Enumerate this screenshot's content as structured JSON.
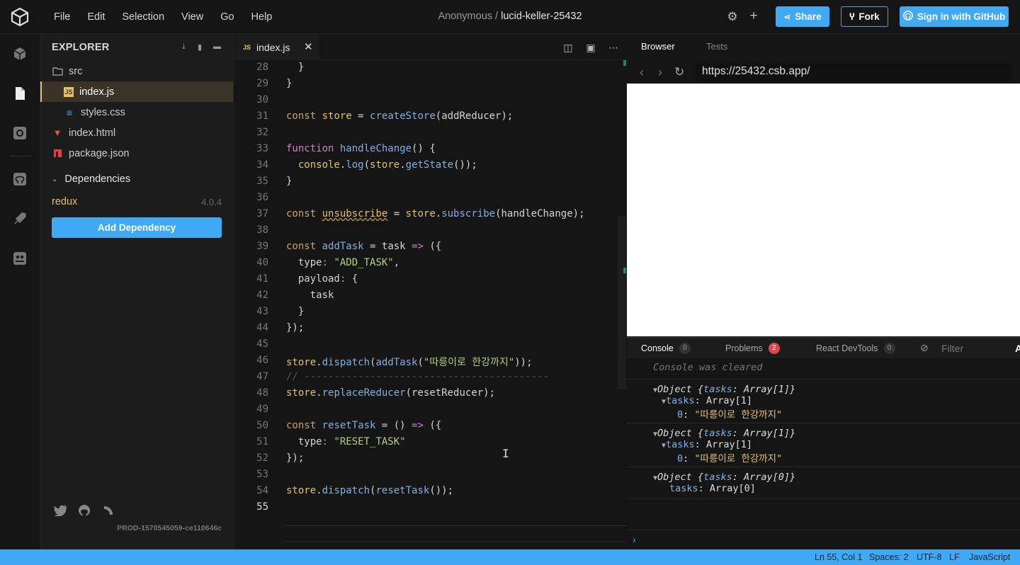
{
  "menu": [
    "File",
    "Edit",
    "Selection",
    "View",
    "Go",
    "Help"
  ],
  "title": {
    "owner": "Anonymous /",
    "project": "lucid-keller-25432"
  },
  "header_buttons": {
    "share": "Share",
    "fork": "Fork",
    "signin": "Sign in with GitHub"
  },
  "explorer": {
    "title": "EXPLORER",
    "files": [
      {
        "name": "src",
        "icon": "folder-icon",
        "depth": 0,
        "active": false
      },
      {
        "name": "index.js",
        "icon": "js-file-icon",
        "depth": 1,
        "active": true
      },
      {
        "name": "styles.css",
        "icon": "css-file-icon",
        "depth": 1,
        "active": false
      },
      {
        "name": "index.html",
        "icon": "html-file-icon",
        "depth": 0,
        "active": false
      },
      {
        "name": "package.json",
        "icon": "npm-file-icon",
        "depth": 0,
        "active": false
      }
    ],
    "dependencies_title": "Dependencies",
    "dependency": {
      "name": "redux",
      "version": "4.0.4"
    },
    "add_dependency": "Add Dependency",
    "build": "PROD-1570545059-ce110646c"
  },
  "editor": {
    "tab": "index.js",
    "lines": [
      {
        "n": "28",
        "html": "  }"
      },
      {
        "n": "29",
        "html": "}"
      },
      {
        "n": "30",
        "html": ""
      },
      {
        "n": "31",
        "html": "<span class='k2'>const</span> <span class='v'>store</span> = <span class='fn'>createStore</span>(addReducer);"
      },
      {
        "n": "32",
        "html": ""
      },
      {
        "n": "33",
        "html": "<span class='k'>function</span> <span class='fn'>handleChange</span>() {"
      },
      {
        "n": "34",
        "html": "  <span class='v'>console</span>.<span class='fn'>log</span>(<span class='v'>store</span>.<span class='fn'>getState</span>());"
      },
      {
        "n": "35",
        "html": "}"
      },
      {
        "n": "36",
        "html": ""
      },
      {
        "n": "37",
        "html": "<span class='k2'>const</span> <span class='v' style='text-decoration: underline wavy #b08a3e;'>unsubscribe</span> = <span class='v'>store</span>.<span class='fn'>subscribe</span>(handleChange);"
      },
      {
        "n": "38",
        "html": ""
      },
      {
        "n": "39",
        "html": "<span class='k2'>const</span> <span class='fn'>addTask</span> = task <span class='k'>=&gt;</span> ({"
      },
      {
        "n": "40",
        "html": "  type<span class='pr'>:</span> <span class='str'>\"ADD_TASK\"</span>,"
      },
      {
        "n": "41",
        "html": "  payload<span class='pr'>:</span> {"
      },
      {
        "n": "42",
        "html": "    task"
      },
      {
        "n": "43",
        "html": "  }"
      },
      {
        "n": "44",
        "html": "});"
      },
      {
        "n": "45",
        "html": ""
      },
      {
        "n": "46",
        "html": "<span class='v'>store</span>.<span class='fn'>dispatch</span>(<span class='fn'>addTask</span>(<span class='str'>\"따릉이로 한강까지\"</span>));"
      },
      {
        "n": "47",
        "html": "<span class='cm'>// -----------------------------------------</span>"
      },
      {
        "n": "48",
        "html": "<span class='v'>store</span>.<span class='fn'>replaceReducer</span>(resetReducer);"
      },
      {
        "n": "49",
        "html": ""
      },
      {
        "n": "50",
        "html": "<span class='k2'>const</span> <span class='fn'>resetTask</span> = () <span class='k'>=&gt;</span> ({"
      },
      {
        "n": "51",
        "html": "  type<span class='pr'>:</span> <span class='str'>\"RESET_TASK\"</span>"
      },
      {
        "n": "52",
        "html": "});"
      },
      {
        "n": "53",
        "html": ""
      },
      {
        "n": "54",
        "html": "<span class='v'>store</span>.<span class='fn'>dispatch</span>(<span class='fn'>resetTask</span>());"
      },
      {
        "n": "55",
        "html": ""
      }
    ]
  },
  "preview": {
    "tabs": [
      "Browser",
      "Tests"
    ],
    "url": "https://25432.csb.app/",
    "console_tabs": [
      {
        "label": "Console",
        "count": "0"
      },
      {
        "label": "Problems",
        "count": "2"
      },
      {
        "label": "React DevTools",
        "count": "0"
      }
    ],
    "filter": "Filter",
    "console_cleared": "Console was cleared",
    "logs": [
      {
        "summary": "Array[1]",
        "array": "Array[1]",
        "item_index": "0",
        "item": "\"따릉이로 한강까지\""
      },
      {
        "summary": "Array[1]",
        "array": "Array[1]",
        "item_index": "0",
        "item": "\"따릉이로 한강까지\""
      },
      {
        "summary": "Array[0]",
        "array": "Array[0]"
      }
    ]
  },
  "status": {
    "position": "Ln 55, Col 1",
    "spaces": "Spaces: 2",
    "encoding": "UTF-8",
    "eol": "LF",
    "language": "JavaScript"
  }
}
